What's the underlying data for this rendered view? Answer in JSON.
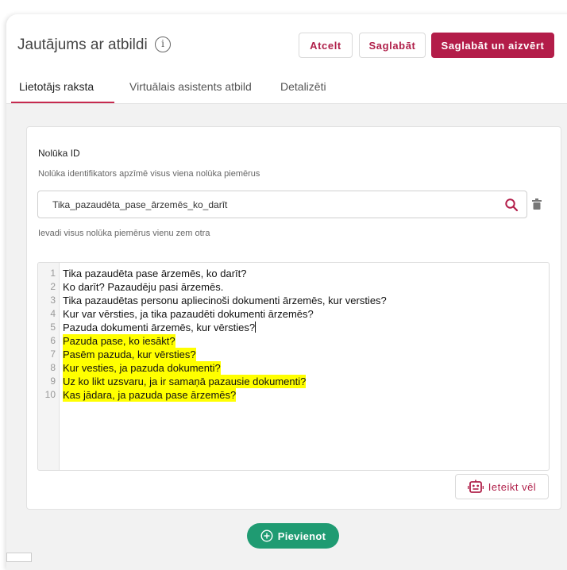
{
  "header": {
    "title": "Jautājums ar atbildi",
    "info_icon": "i",
    "cancel_label": "Atcelt",
    "save_label": "Saglabāt",
    "save_close_label": "Saglabāt un aizvērt"
  },
  "tabs": [
    {
      "label": "Lietotājs raksta",
      "active": true
    },
    {
      "label": "Virtuālais asistents atbild",
      "active": false
    },
    {
      "label": "Detalizēti",
      "active": false
    }
  ],
  "form": {
    "intent_label": "Nolūka ID",
    "intent_hint": "Nolūka identifikators apzīmē visus viena nolūka piemērus",
    "intent_value": "Tika_pazaudēta_pase_ārzemēs_ko_darīt",
    "examples_hint": "Ievadi visus nolūka piemērus vienu zem otra"
  },
  "examples": [
    {
      "n": "1",
      "text": "Tika pazaudēta pase ārzemēs, ko darīt?",
      "highlight": false
    },
    {
      "n": "2",
      "text": "Ko darīt? Pazaudēju pasi ārzemēs.",
      "highlight": false
    },
    {
      "n": "3",
      "text": "Tika pazaudētas personu apliecinoši dokumenti ārzemēs, kur versties?",
      "highlight": false
    },
    {
      "n": "4",
      "text": "Kur var vērsties, ja tika pazaudēti dokumenti ārzemēs?",
      "highlight": false
    },
    {
      "n": "5",
      "text": "Pazuda dokumenti ārzemēs, kur vērsties?",
      "highlight": false
    },
    {
      "n": "6",
      "text": "Pazuda pase, ko iesākt?",
      "highlight": true
    },
    {
      "n": "7",
      "text": "Pasēm pazuda, kur vērsties?",
      "highlight": true
    },
    {
      "n": "8",
      "text": "Kur vesties, ja pazuda dokumenti?",
      "highlight": true
    },
    {
      "n": "9",
      "text": "Uz ko likt uzsvaru, ja ir samaņā pazausie dokumenti?",
      "highlight": true
    },
    {
      "n": "10",
      "text": "Kas jādara, ja pazuda pase ārzemēs?",
      "highlight": true
    }
  ],
  "actions": {
    "generate_label": "Ieteikt vēl",
    "add_label": "Pievienot"
  },
  "colors": {
    "accent": "#b31d49",
    "add_button": "#1f9b72",
    "highlight": "#ffff00"
  },
  "icons": {
    "info": "info-icon",
    "search": "search-icon",
    "trash": "trash-icon",
    "robot": "robot-icon",
    "plus": "plus-circle-icon"
  }
}
